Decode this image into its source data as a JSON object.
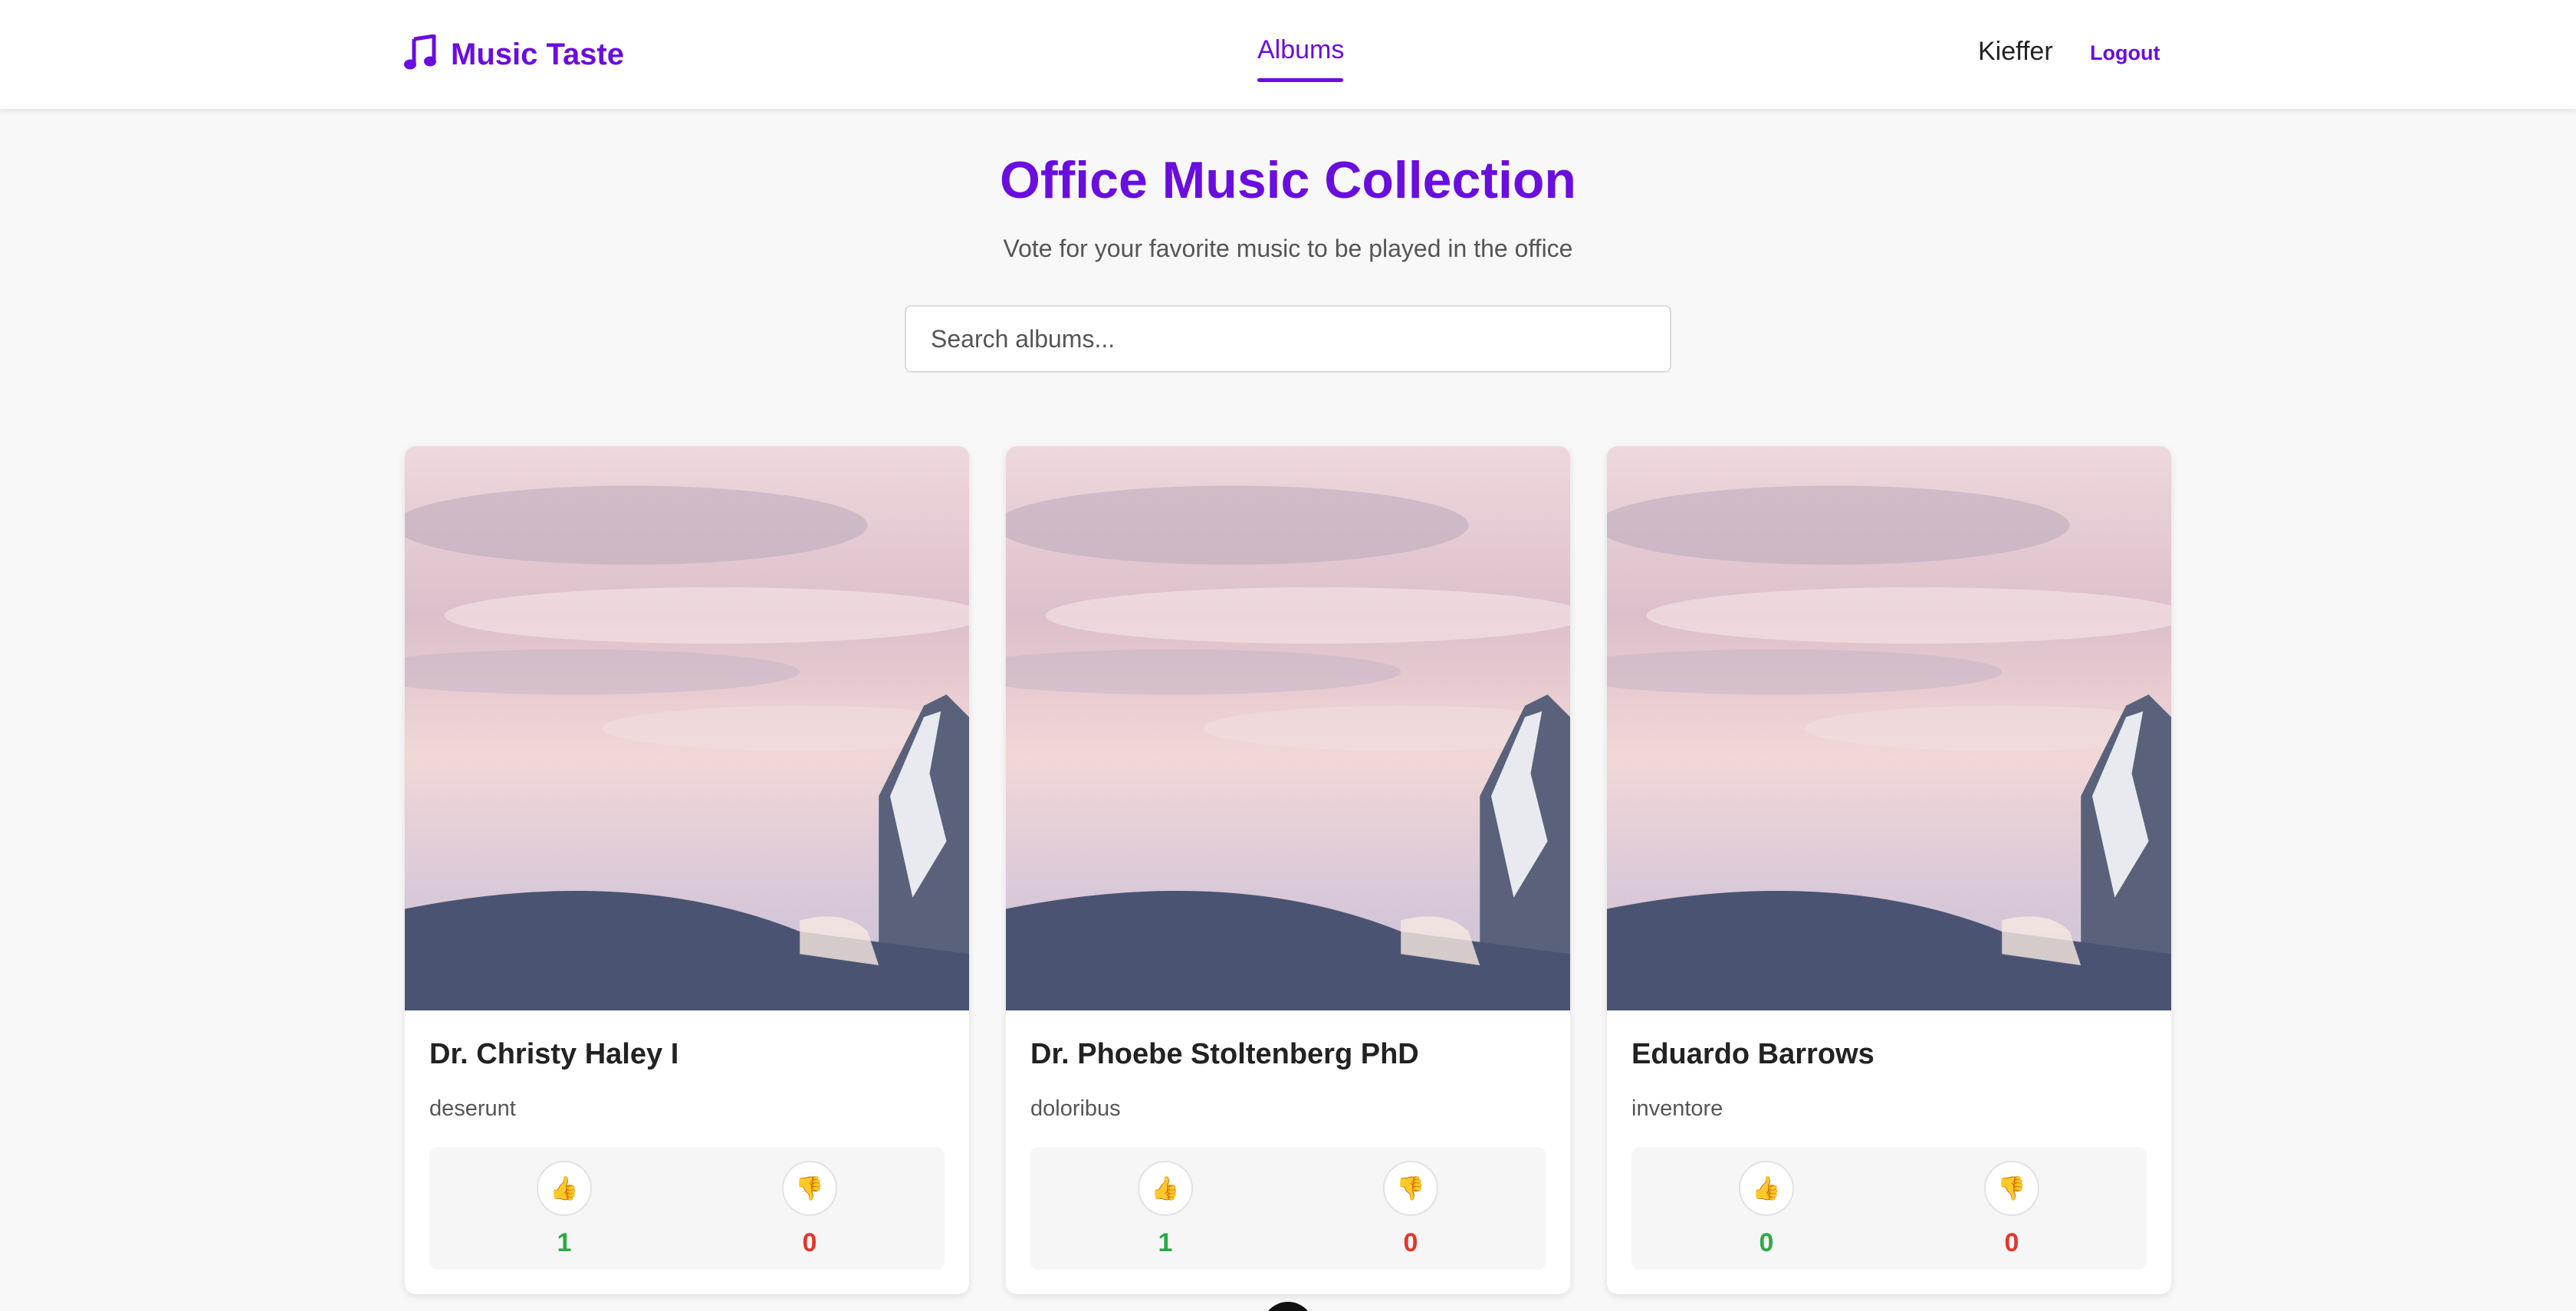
{
  "header": {
    "brand": "Music Taste",
    "brand_icon": "music-note-icon",
    "nav": {
      "albums": "Albums"
    },
    "user": "Kieffer",
    "logout": "Logout",
    "accent_color": "#6a0ddf"
  },
  "hero": {
    "title": "Office Music Collection",
    "subtitle": "Vote for your favorite music to be played in the office"
  },
  "search": {
    "placeholder": "Search albums...",
    "value": ""
  },
  "albums": [
    {
      "title": "Dr. Christy Haley I",
      "subtitle": "deserunt",
      "upvotes": "1",
      "downvotes": "0"
    },
    {
      "title": "Dr. Phoebe Stoltenberg PhD",
      "subtitle": "doloribus",
      "upvotes": "1",
      "downvotes": "0"
    },
    {
      "title": "Eduardo Barrows",
      "subtitle": "inventore",
      "upvotes": "0",
      "downvotes": "0"
    }
  ],
  "icons": {
    "upvote": "thumbs-up-icon",
    "downvote": "thumbs-down-icon"
  },
  "colors": {
    "upvote": "#2ea84a",
    "downvote": "#e4352b",
    "page_background": "#f8f8f8"
  }
}
